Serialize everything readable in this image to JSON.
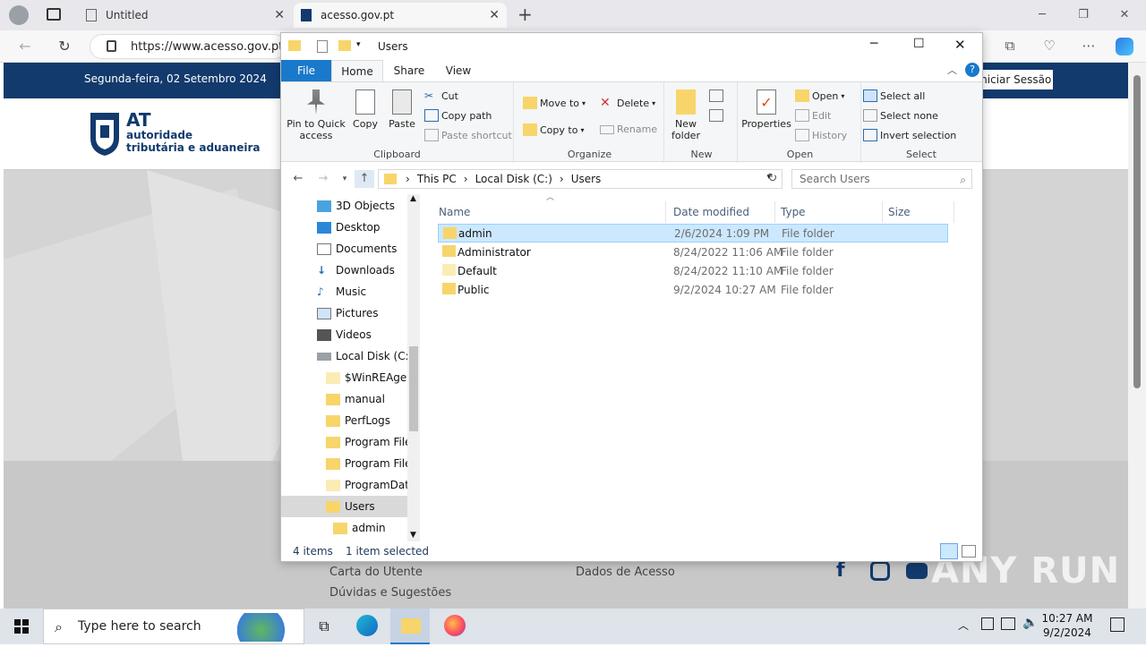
{
  "browser": {
    "tabs": [
      {
        "label": "Untitled",
        "active": false
      },
      {
        "label": "acesso.gov.pt",
        "active": true
      }
    ],
    "url": "https://www.acesso.gov.pt/",
    "url_display": "https://www.acesso.gov.pt/"
  },
  "site": {
    "date": "Segunda-feira, 02 Setembro 2024",
    "login_label": "Iniciar Sessão",
    "logo": {
      "mark": "AT",
      "line1": "autoridade",
      "line2": "tributária e aduaneira"
    },
    "footer_links": [
      "Carta do Utente",
      "Dúvidas e Sugestões",
      "Dados de Acesso"
    ],
    "watermark": "ANY RUN"
  },
  "explorer": {
    "title": "Users",
    "ribbon_tabs": [
      "File",
      "Home",
      "Share",
      "View"
    ],
    "clipboard": {
      "label": "Clipboard",
      "pin": "Pin to Quick access",
      "copy": "Copy",
      "paste": "Paste",
      "cut": "Cut",
      "copy_path": "Copy path",
      "paste_shortcut": "Paste shortcut"
    },
    "organize": {
      "label": "Organize",
      "move_to": "Move to",
      "copy_to": "Copy to",
      "delete": "Delete",
      "rename": "Rename"
    },
    "new": {
      "label": "New",
      "new_folder": "New folder"
    },
    "open": {
      "label": "Open",
      "properties": "Properties",
      "open": "Open",
      "edit": "Edit",
      "history": "History"
    },
    "select": {
      "label": "Select",
      "select_all": "Select all",
      "select_none": "Select none",
      "invert": "Invert selection"
    },
    "path": [
      "This PC",
      "Local Disk (C:)",
      "Users"
    ],
    "search_placeholder": "Search Users",
    "nav_items": [
      {
        "label": "3D Objects",
        "icon": "3d-objects-icon",
        "indent": 0
      },
      {
        "label": "Desktop",
        "icon": "desktop-icon",
        "indent": 0
      },
      {
        "label": "Documents",
        "icon": "documents-icon",
        "indent": 0
      },
      {
        "label": "Downloads",
        "icon": "downloads-icon",
        "indent": 0
      },
      {
        "label": "Music",
        "icon": "music-icon",
        "indent": 0
      },
      {
        "label": "Pictures",
        "icon": "pictures-icon",
        "indent": 0
      },
      {
        "label": "Videos",
        "icon": "videos-icon",
        "indent": 0
      },
      {
        "label": "Local Disk (C:)",
        "icon": "drive-icon",
        "indent": 0
      },
      {
        "label": "$WinREAgent",
        "icon": "folder-icon",
        "indent": 1
      },
      {
        "label": "manual",
        "icon": "folder-icon",
        "indent": 1
      },
      {
        "label": "PerfLogs",
        "icon": "folder-icon",
        "indent": 1
      },
      {
        "label": "Program Files",
        "icon": "folder-icon",
        "indent": 1
      },
      {
        "label": "Program Files",
        "icon": "folder-icon",
        "indent": 1
      },
      {
        "label": "ProgramData",
        "icon": "folder-icon",
        "indent": 1
      },
      {
        "label": "Users",
        "icon": "folder-icon",
        "indent": 1,
        "selected": true
      },
      {
        "label": "admin",
        "icon": "folder-icon",
        "indent": 2
      }
    ],
    "columns": [
      "Name",
      "Date modified",
      "Type",
      "Size"
    ],
    "files": [
      {
        "name": "admin",
        "date": "2/6/2024 1:09 PM",
        "type": "File folder",
        "selected": true
      },
      {
        "name": "Administrator",
        "date": "8/24/2022 11:06 AM",
        "type": "File folder",
        "selected": false
      },
      {
        "name": "Default",
        "date": "8/24/2022 11:10 AM",
        "type": "File folder",
        "selected": false
      },
      {
        "name": "Public",
        "date": "9/2/2024 10:27 AM",
        "type": "File folder",
        "selected": false
      }
    ],
    "status_items": "4 items",
    "status_selected": "1 item selected"
  },
  "taskbar": {
    "search_placeholder": "Type here to search",
    "time": "10:27 AM",
    "date": "9/2/2024"
  },
  "colors": {
    "accent": "#1979ca",
    "selection": "#cce8ff",
    "site_header": "#123a6d"
  }
}
